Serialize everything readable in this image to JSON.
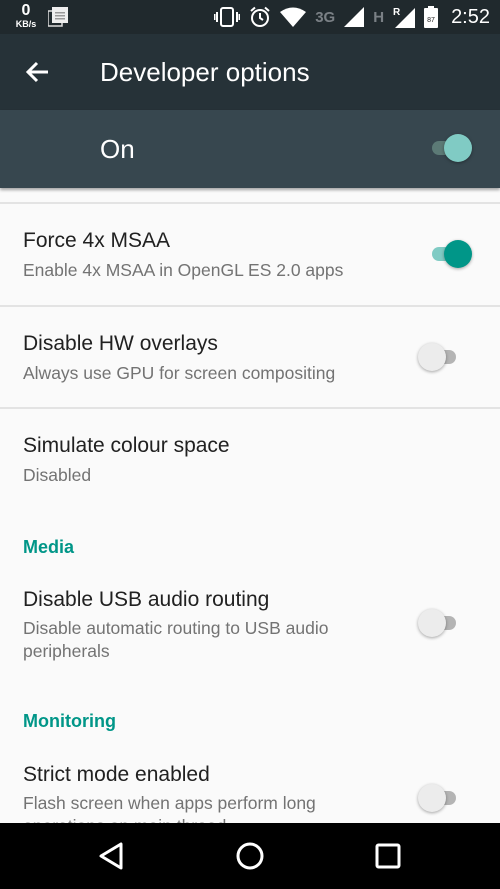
{
  "status_bar": {
    "net_speed_value": "0",
    "net_speed_unit": "KB/s",
    "network_type_1": "3G",
    "network_type_2": "H",
    "roaming_indicator": "R",
    "battery_level": "87",
    "time": "2:52",
    "icons": [
      "network-speed",
      "notification-icon",
      "vibrate-icon",
      "alarm-icon",
      "wifi-icon",
      "signal-icon",
      "signal-roaming-icon",
      "battery-icon"
    ]
  },
  "app_bar": {
    "back_icon": "arrow-left",
    "title": "Developer options"
  },
  "master_switch": {
    "label": "On",
    "checked": true
  },
  "colors": {
    "accent": "#009688",
    "app_bar": "#263238",
    "master_bar": "#37474f",
    "status_bar": "#20292d"
  },
  "preferences": [
    {
      "title": "Force 4x MSAA",
      "summary": "Enable 4x MSAA in OpenGL ES 2.0 apps",
      "type": "switch",
      "checked": true
    },
    {
      "title": "Disable HW overlays",
      "summary": "Always use GPU for screen compositing",
      "type": "switch",
      "checked": false
    },
    {
      "title": "Simulate colour space",
      "summary": "Disabled",
      "type": "list"
    }
  ],
  "categories": {
    "media": {
      "title": "Media",
      "items": [
        {
          "title": "Disable USB audio routing",
          "summary": "Disable automatic routing to USB audio peripherals",
          "type": "switch",
          "checked": false
        }
      ]
    },
    "monitoring": {
      "title": "Monitoring",
      "items": [
        {
          "title": "Strict mode enabled",
          "summary": "Flash screen when apps perform long operations on main thread",
          "type": "switch",
          "checked": false
        }
      ]
    }
  },
  "nav_bar": {
    "buttons": [
      "back",
      "home",
      "recents"
    ]
  }
}
